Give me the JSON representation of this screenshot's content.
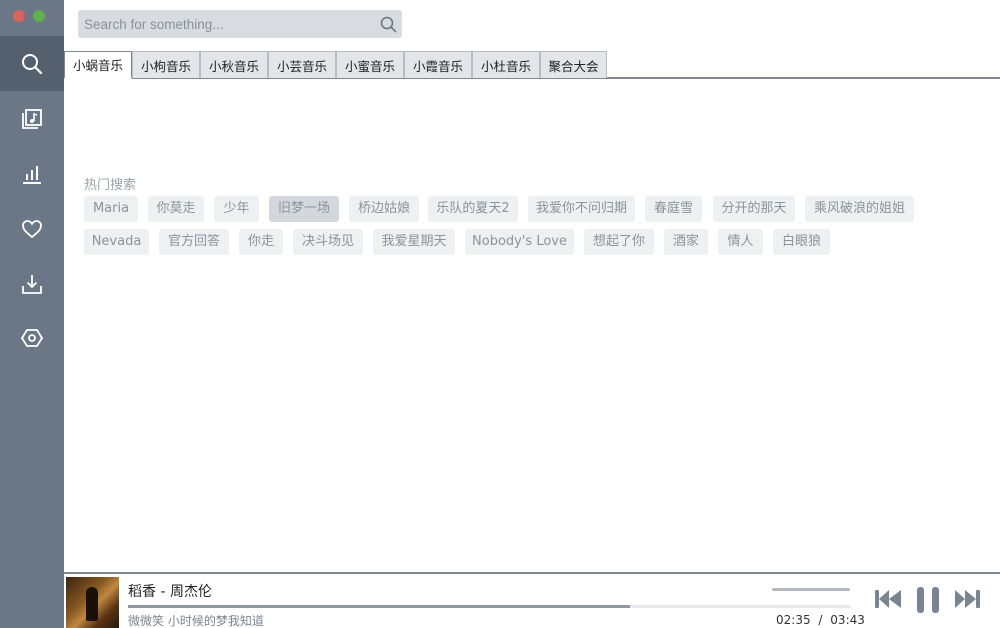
{
  "search": {
    "placeholder": "Search for something..."
  },
  "sidebar": {
    "items": [
      {
        "name": "search",
        "icon": "search-icon",
        "active": true
      },
      {
        "name": "library",
        "icon": "music-library-icon",
        "active": false
      },
      {
        "name": "charts",
        "icon": "bar-chart-icon",
        "active": false
      },
      {
        "name": "favorites",
        "icon": "heart-icon",
        "active": false
      },
      {
        "name": "downloads",
        "icon": "download-icon",
        "active": false
      },
      {
        "name": "settings",
        "icon": "settings-icon",
        "active": false
      }
    ]
  },
  "tabs": [
    {
      "label": "小蜗音乐",
      "active": true
    },
    {
      "label": "小枸音乐",
      "active": false
    },
    {
      "label": "小秋音乐",
      "active": false
    },
    {
      "label": "小芸音乐",
      "active": false
    },
    {
      "label": "小蜜音乐",
      "active": false
    },
    {
      "label": "小霞音乐",
      "active": false
    },
    {
      "label": "小杜音乐",
      "active": false
    },
    {
      "label": "聚合大会",
      "active": false
    }
  ],
  "hot": {
    "title": "热门搜索",
    "row1": [
      "Maria",
      "你莫走",
      "少年",
      "旧梦一场",
      "桥边姑娘",
      "乐队的夏天2",
      "我爱你不问归期",
      "春庭雪",
      "分开的那天",
      "乘风破浪的姐姐"
    ],
    "row2": [
      "Nevada",
      "官方回答",
      "你走",
      "决斗场见",
      "我爱星期天",
      "Nobody's Love",
      "想起了你",
      "酒家",
      "情人",
      "白眼狼"
    ],
    "selected": "旧梦一场"
  },
  "player": {
    "title": "稻香 - 周杰伦",
    "lyric": "微微笑 小时候的梦我知道",
    "current_time": "02:35",
    "separator": "/",
    "total_time": "03:43",
    "progress": 0.695,
    "controls": [
      "previous-icon",
      "pause-icon",
      "next-icon"
    ]
  },
  "colors": {
    "sidebar": "#6b7786",
    "sidebar_active": "#55606e",
    "chip_bg": "#eef0f2",
    "chip_text": "#8b939c"
  }
}
